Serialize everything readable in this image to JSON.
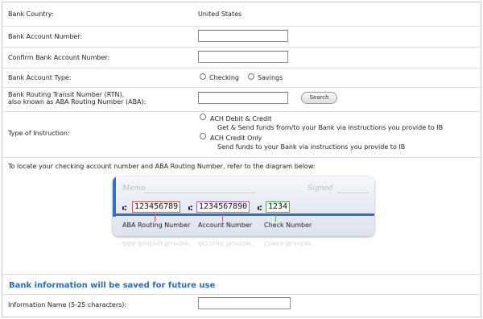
{
  "bank_country": {
    "label": "Bank Country:",
    "value": "United States"
  },
  "account_number": {
    "label": "Bank Account Number:",
    "value": ""
  },
  "confirm_account_number": {
    "label": "Confirm Bank Account Number:",
    "value": ""
  },
  "account_type": {
    "label": "Bank Account Type:",
    "options": [
      {
        "label": "Checking",
        "selected": false
      },
      {
        "label": "Savings",
        "selected": false
      }
    ]
  },
  "routing_number": {
    "label_line1": "Bank Routing Transit Number (RTN),",
    "label_line2": "also known as ABA Routing Number (ABA):",
    "value": "",
    "search_label": "Search"
  },
  "instruction": {
    "label": "Type of Instruction:",
    "options": [
      {
        "label": "ACH Debit & Credit",
        "description": "Get & Send funds from/to your Bank via instructions you provide to IB",
        "selected": false
      },
      {
        "label": "ACH Credit Only",
        "description": "Send funds to your Bank via instructions you provide to IB",
        "selected": false
      }
    ]
  },
  "diagram": {
    "intro": "To locate your checking account number and ABA Routing Number, refer to the diagram below:",
    "memo": "Memo",
    "signed": "Signed",
    "micr_symbol": "⑆",
    "routing_value": "123456789",
    "account_value": "1234567890",
    "check_value": "1234",
    "routing_caption": "ABA Routing Number",
    "account_caption": "Account Number",
    "check_caption": "Check Number",
    "colors": {
      "routing": "#d9534f",
      "account": "#b45ad8",
      "check": "#4caf50",
      "stripe": "#2f6fd0"
    }
  },
  "save_section": {
    "title": "Bank information will be saved for future use",
    "info_name_label": "Information Name (5-25 characters):",
    "info_name_value": ""
  }
}
